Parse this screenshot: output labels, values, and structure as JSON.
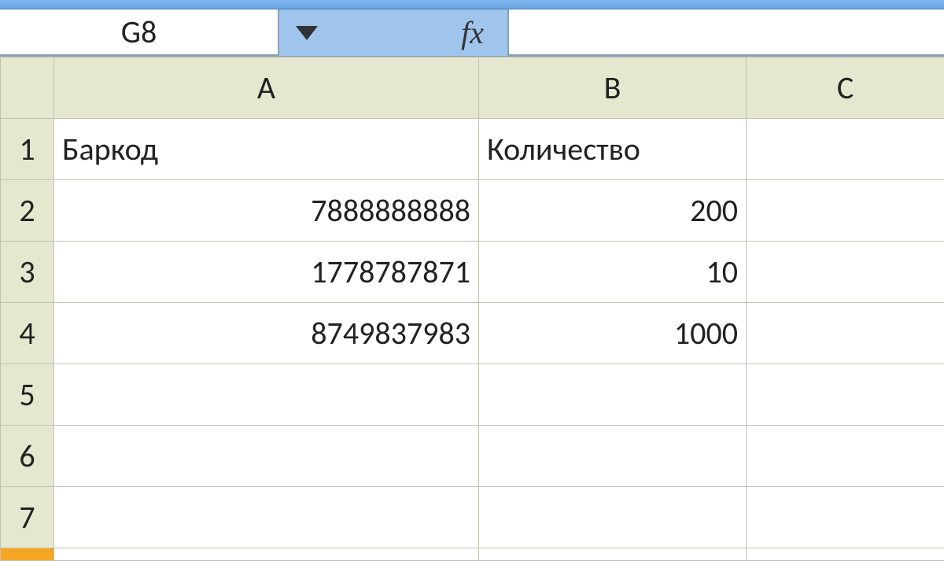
{
  "formula_bar": {
    "name_box": "G8",
    "fx_label": "fx",
    "formula_value": ""
  },
  "columns": [
    "A",
    "B",
    "C"
  ],
  "rows": [
    "1",
    "2",
    "3",
    "4",
    "5",
    "6",
    "7"
  ],
  "cells": {
    "A1": "Баркод",
    "B1": "Количество",
    "A2": "7888888888",
    "B2": "200",
    "A3": "1778787871",
    "B3": "10",
    "A4": "8749837983",
    "B4": "1000"
  }
}
